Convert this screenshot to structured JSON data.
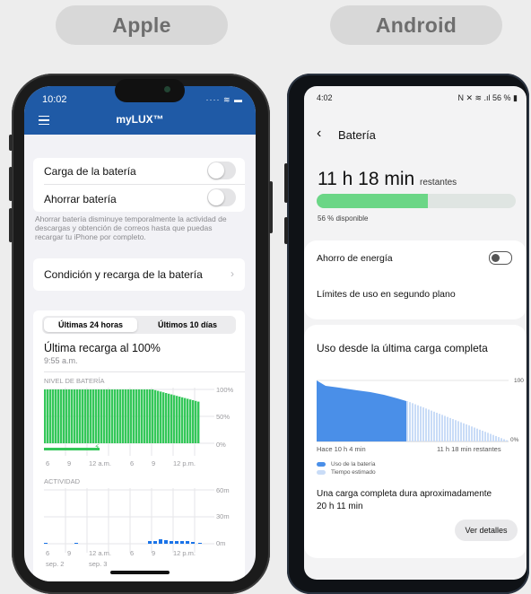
{
  "header": {
    "apple_label": "Apple",
    "android_label": "Android"
  },
  "apple": {
    "status_time": "10:02",
    "app_title": "myLUX™",
    "battery_charge_label": "Carga de la batería",
    "save_battery_label": "Ahorrar batería",
    "save_battery_note": "Ahorrar batería disminuye temporalmente la actividad de descargas y obtención de correos hasta que puedas recargar tu iPhone por completo.",
    "health_label": "Condición y recarga de la batería",
    "tabs": [
      "Últimas 24 horas",
      "Últimos 10 días"
    ],
    "last_charge_title": "Última recarga al 100%",
    "last_charge_time": "9:55 a.m.",
    "level_title": "NIVEL DE BATERÍA",
    "level_ticks": [
      "100%",
      "50%",
      "0%"
    ],
    "activity_title": "ACTIVIDAD",
    "activity_ticks": [
      "60m",
      "30m",
      "0m"
    ],
    "x_labels": [
      "6",
      "9",
      "12 a.m.",
      "6",
      "9",
      "12 p.m."
    ],
    "date_labels": [
      "sep. 2",
      "sep. 3"
    ],
    "colors": {
      "header": "#1f5aa6",
      "level": "#34c759",
      "activity": "#1a73e8"
    }
  },
  "android": {
    "status_time": "4:02",
    "status_right": "56 %",
    "page_title": "Batería",
    "remaining_value": "11 h 18 min",
    "remaining_unit": "restantes",
    "percent_label": "56 % disponible",
    "battery_fraction": 0.56,
    "power_saving_label": "Ahorro de energía",
    "background_limits_label": "Límites de uso en segundo plano",
    "usage_title": "Uso desde la última carga completa",
    "chart_y_top": "100",
    "chart_y_bottom": "0%",
    "chart_x_start": "Hace 10 h 4 min",
    "chart_x_end": "11 h 18 min restantes",
    "legend_used": "Uso de la batería",
    "legend_estimated": "Tiempo estimado",
    "full_charge_text": "Una carga completa dura aproximadamente",
    "full_charge_value": "20 h 11 min",
    "details_button": "Ver detalles",
    "colors": {
      "used": "#4a8fe8",
      "estimated": "#c9dcf7",
      "bar": "#6bd686"
    }
  }
}
